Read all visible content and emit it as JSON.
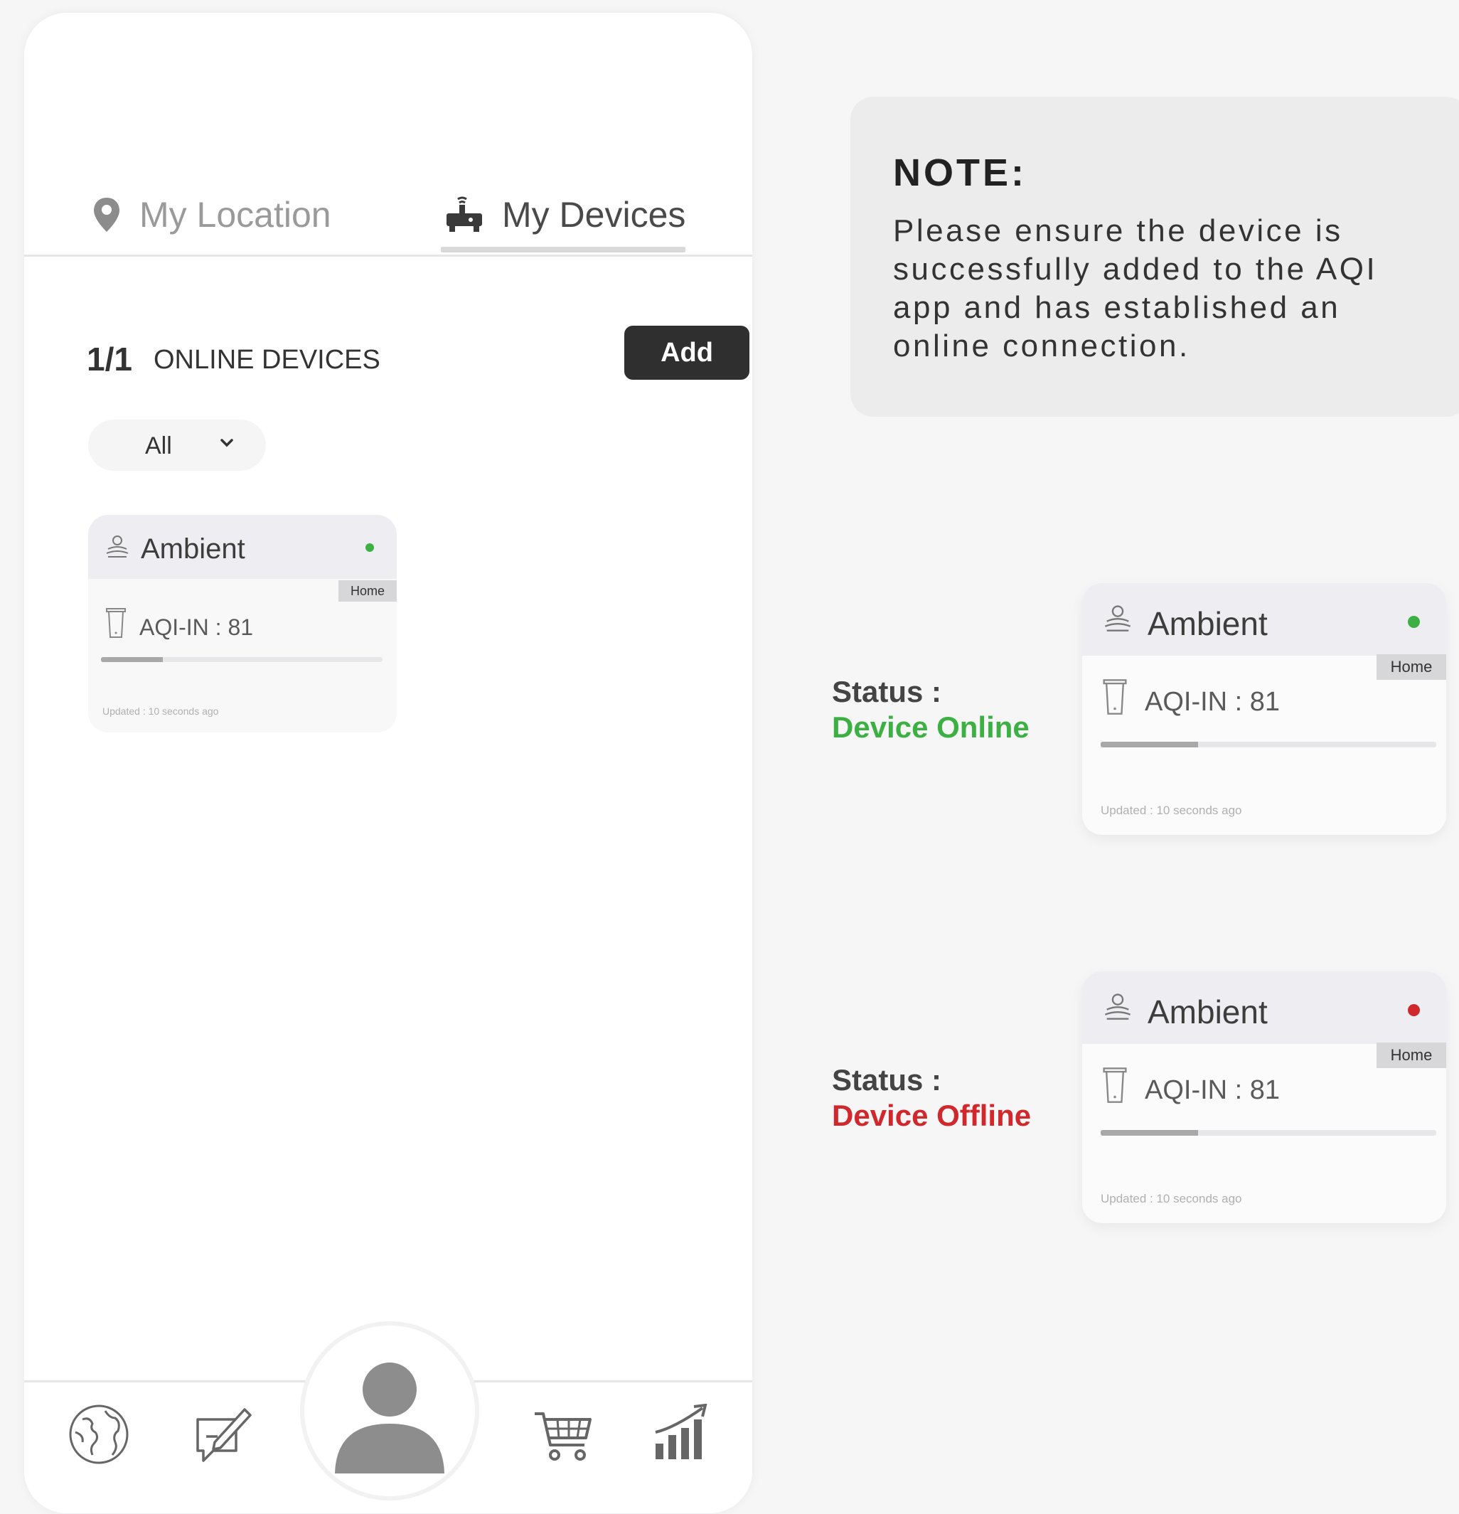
{
  "tabs": [
    {
      "label": "My Location",
      "icon": "map-pin-icon"
    },
    {
      "label": "My Devices",
      "icon": "device-router-icon"
    }
  ],
  "online": {
    "count": "1/1",
    "label": "ONLINE DEVICES",
    "add_label": "Add"
  },
  "filter": {
    "selected": "All"
  },
  "colors": {
    "online": "#3cb043",
    "offline": "#d0282c",
    "button": "#2f2f2f"
  },
  "cards": [
    {
      "name": "Ambient",
      "status": "online",
      "badge": "Home",
      "aqi": "AQI-IN : 81",
      "progress": 0.22,
      "updated": "Updated : 10 seconds ago"
    },
    {
      "name": "Ambient",
      "status": "online",
      "badge": "Home",
      "aqi": "AQI-IN : 81",
      "progress": 0.29,
      "updated": "Updated : 10 seconds ago"
    },
    {
      "name": "Ambient",
      "status": "offline",
      "badge": "Home",
      "aqi": "AQI-IN : 81",
      "progress": 0.29,
      "updated": "Updated : 10 seconds ago"
    }
  ],
  "note": {
    "title": "NOTE:",
    "text": "Please ensure the device is successfully added to the AQI app and has established an online connection."
  },
  "status_online": {
    "label": "Status :",
    "value": "Device Online"
  },
  "status_offline": {
    "label": "Status :",
    "value": "Device Offline"
  },
  "nav": [
    "globe-icon",
    "feedback-pen-icon",
    "profile-avatar-icon",
    "shopping-cart-icon",
    "chart-growth-icon"
  ]
}
